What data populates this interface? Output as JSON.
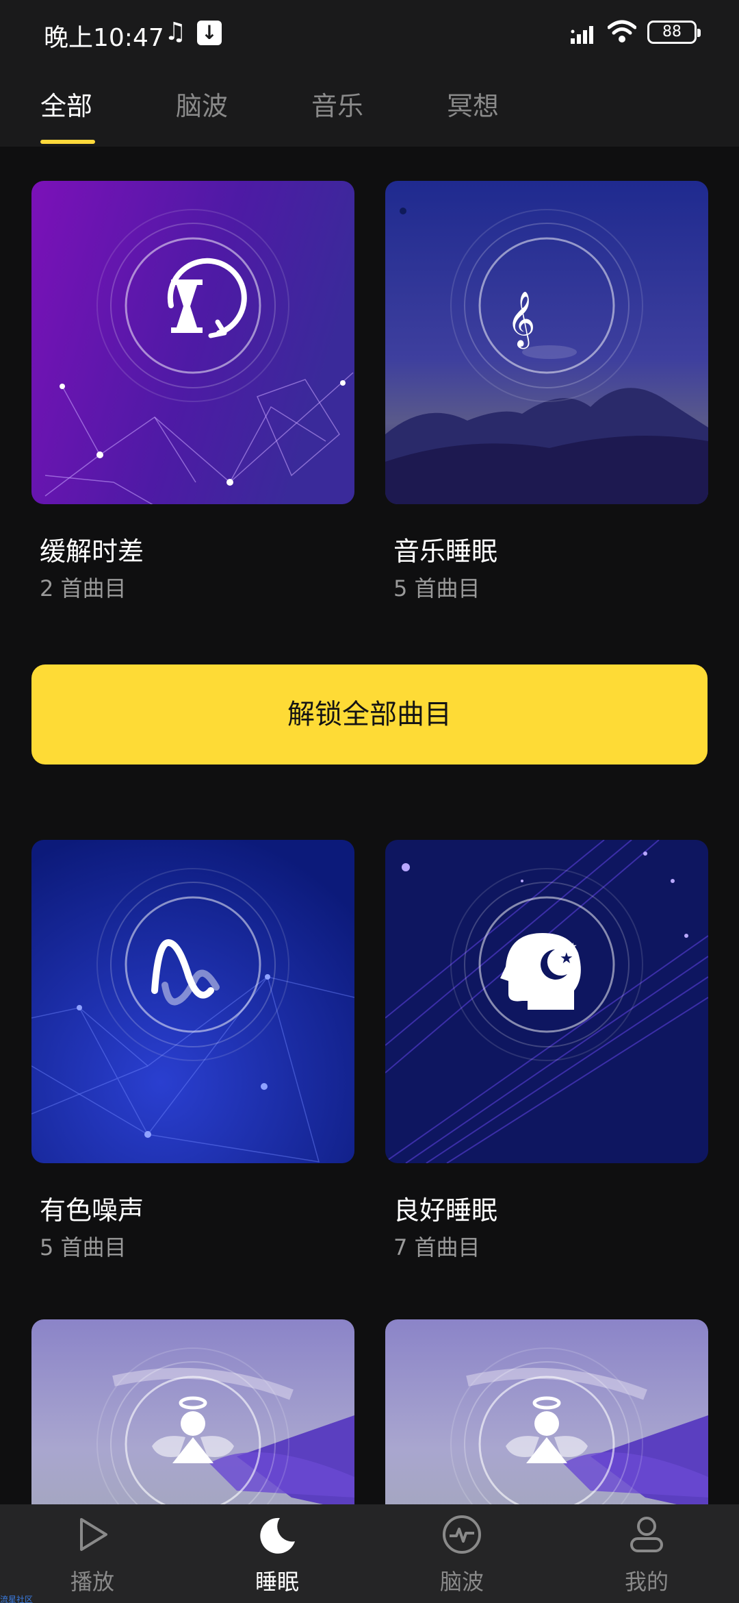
{
  "status_bar": {
    "time": "晚上10:47",
    "battery": "88",
    "icons": [
      "music-note-icon",
      "download-icon",
      "signal-icon",
      "wifi-icon",
      "battery-icon"
    ]
  },
  "tabs": [
    {
      "label": "全部",
      "active": true
    },
    {
      "label": "脑波",
      "active": false
    },
    {
      "label": "音乐",
      "active": false
    },
    {
      "label": "冥想",
      "active": false
    }
  ],
  "cards": [
    {
      "title": "缓解时差",
      "subtitle": "2 首曲目",
      "icon": "hourglass-refresh-icon"
    },
    {
      "title": "音乐睡眠",
      "subtitle": "5 首曲目",
      "icon": "music-moon-icon"
    },
    {
      "title": "有色噪声",
      "subtitle": "5 首曲目",
      "icon": "wave-icon"
    },
    {
      "title": "良好睡眠",
      "subtitle": "7 首曲目",
      "icon": "head-moon-icon"
    },
    {
      "title": "",
      "subtitle": "",
      "icon": "angel-icon"
    },
    {
      "title": "",
      "subtitle": "",
      "icon": "angel-icon"
    }
  ],
  "unlock_button": {
    "label": "解锁全部曲目"
  },
  "bottom_nav": [
    {
      "label": "播放",
      "icon": "play-icon",
      "active": false
    },
    {
      "label": "睡眠",
      "icon": "moon-icon",
      "active": true
    },
    {
      "label": "脑波",
      "icon": "brainwave-icon",
      "active": false
    },
    {
      "label": "我的",
      "icon": "profile-icon",
      "active": false
    }
  ],
  "watermark": "流星社区",
  "colors": {
    "accent": "#fedb36",
    "background": "#0f0f10",
    "bar": "#1a1a1b",
    "nav": "#252526"
  }
}
